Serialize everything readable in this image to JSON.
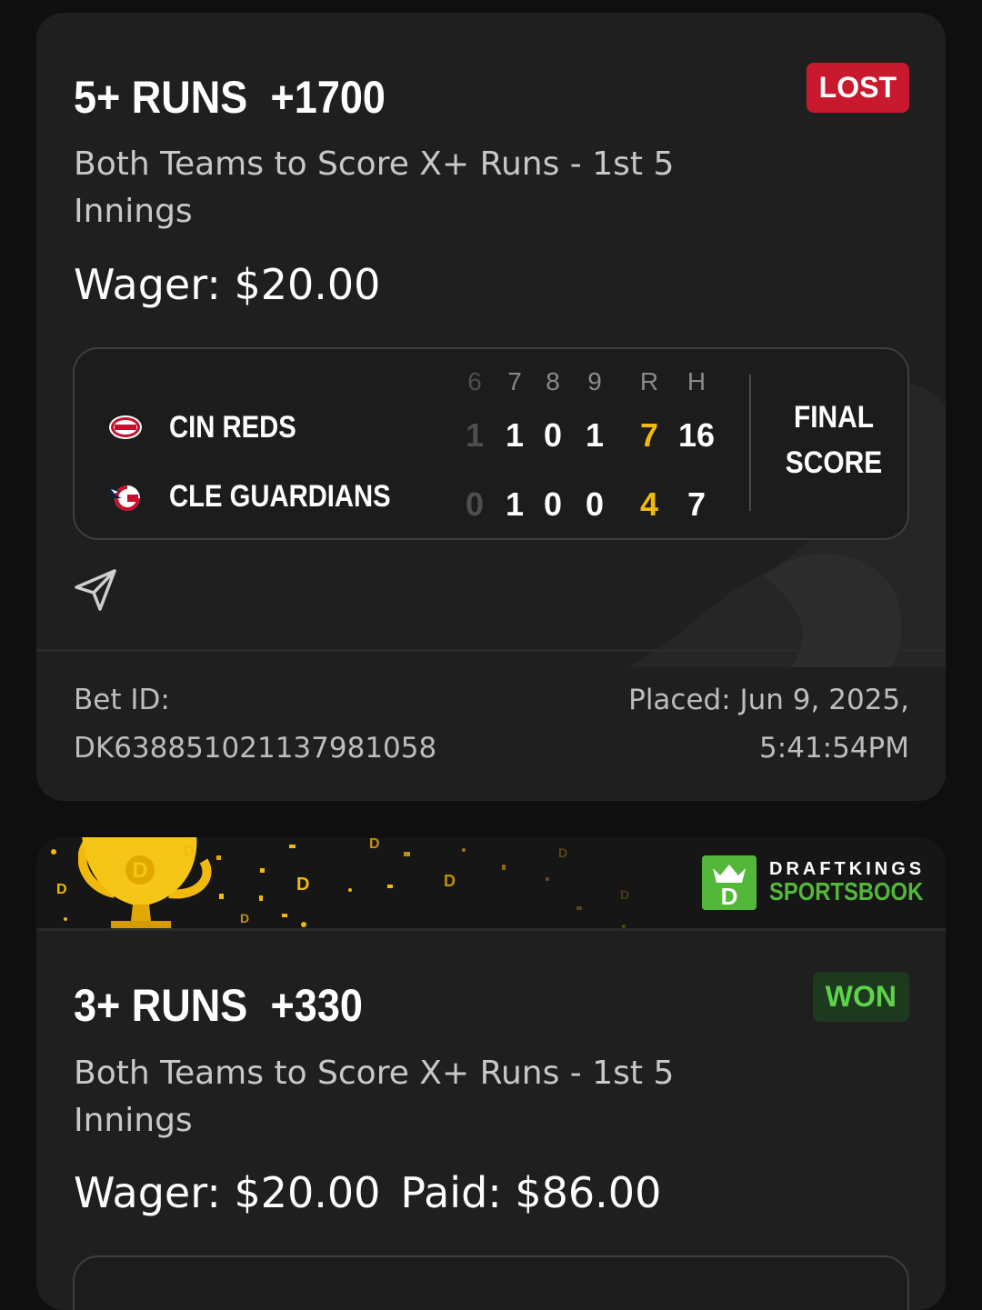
{
  "bets": [
    {
      "selection": "5+ RUNS",
      "odds": "+1700",
      "status": "LOST",
      "market": "Both Teams to Score X+ Runs - 1st 5 Innings",
      "wager_text": "Wager: $20.00",
      "scoreboard": {
        "innings": [
          "6",
          "7",
          "8",
          "9"
        ],
        "r_label": "R",
        "h_label": "H",
        "teams": [
          {
            "name": "CIN REDS",
            "logo": "reds-logo-icon",
            "innings": [
              "1",
              "1",
              "0",
              "1"
            ],
            "r": "7",
            "h": "16"
          },
          {
            "name": "CLE GUARDIANS",
            "logo": "guardians-logo-icon",
            "innings": [
              "0",
              "1",
              "0",
              "0"
            ],
            "r": "4",
            "h": "7"
          }
        ],
        "status_line1": "FINAL",
        "status_line2": "SCORE"
      },
      "bet_id_label": "Bet ID:",
      "bet_id": "DK638851021137981058",
      "placed_line1": "Placed: Jun 9, 2025,",
      "placed_line2": "5:41:54PM"
    },
    {
      "selection": "3+ RUNS",
      "odds": "+330",
      "status": "WON",
      "market": "Both Teams to Score X+ Runs - 1st 5 Innings",
      "wager_text": "Wager: $20.00",
      "paid_text": "Paid: $86.00"
    }
  ],
  "brand": {
    "line1": "DRAFTKINGS",
    "line2": "SPORTSBOOK",
    "color": "#53b83a"
  },
  "colors": {
    "lost": "#c8192e",
    "won": "#5fd14a",
    "runs": "#f0b90b"
  }
}
